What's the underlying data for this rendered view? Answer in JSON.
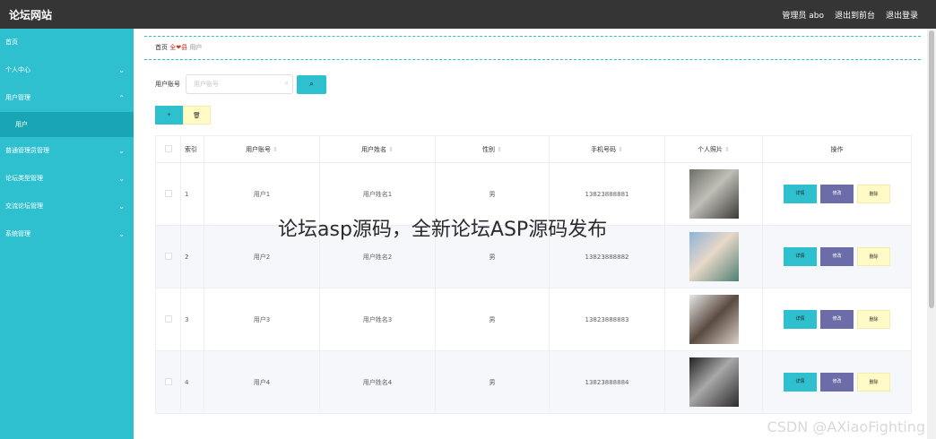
{
  "header": {
    "title": "论坛网站",
    "admin_label": "管理员 abo",
    "back_to_front": "退出到前台",
    "logout": "退出登录"
  },
  "sidebar": {
    "items": [
      {
        "label": "首页",
        "chevron": ""
      },
      {
        "label": "个人中心",
        "chevron": "⌄"
      },
      {
        "label": "用户管理",
        "chevron": "⌃"
      },
      {
        "label": "用户",
        "chevron": ""
      },
      {
        "label": "普通管理员管理",
        "chevron": "⌄"
      },
      {
        "label": "论坛类型管理",
        "chevron": "⌄"
      },
      {
        "label": "交流论坛管理",
        "chevron": "⌄"
      },
      {
        "label": "系统管理",
        "chevron": "⌄"
      }
    ]
  },
  "breadcrumb": {
    "home": "首页",
    "separator": "全❤县",
    "current": "用户"
  },
  "search": {
    "label": "用户账号",
    "placeholder": "用户账号",
    "button_icon": "search-icon"
  },
  "actions": {
    "add_label": "+",
    "delete_label": "🗑"
  },
  "table": {
    "headers": {
      "index": "索引",
      "account": "用户账号",
      "name": "用户姓名",
      "gender": "性别",
      "phone": "手机号码",
      "photo": "个人照片",
      "ops": "操作"
    },
    "rows": [
      {
        "index": "1",
        "account": "用户1",
        "name": "用户姓名1",
        "gender": "男",
        "phone": "13823888881"
      },
      {
        "index": "2",
        "account": "用户2",
        "name": "用户姓名2",
        "gender": "男",
        "phone": "13823888882"
      },
      {
        "index": "3",
        "account": "用户3",
        "name": "用户姓名3",
        "gender": "男",
        "phone": "13823888883"
      },
      {
        "index": "4",
        "account": "用户4",
        "name": "用户姓名4",
        "gender": "男",
        "phone": "13823888884"
      }
    ],
    "op_labels": {
      "detail": "详情",
      "edit": "修改",
      "remove": "删除"
    }
  },
  "overlay": {
    "title": "论坛asp源码，全新论坛ASP源码发布",
    "watermark": "CSDN @AXiaoFighting"
  },
  "colors": {
    "accent": "#2ec0cf",
    "topbar": "#353535",
    "edit": "#6b6ca8",
    "delete": "#fffac6"
  }
}
